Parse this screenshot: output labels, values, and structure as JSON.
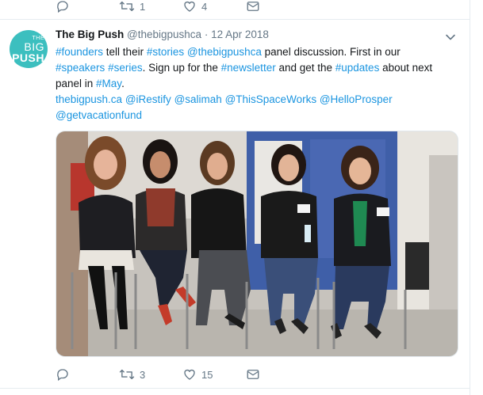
{
  "previous_tweet": {
    "actions": [
      {
        "name": "reply",
        "icon": "reply-icon",
        "count": ""
      },
      {
        "name": "retweet",
        "icon": "retweet-icon",
        "count": "1"
      },
      {
        "name": "like",
        "icon": "heart-icon",
        "count": "4"
      },
      {
        "name": "message",
        "icon": "envelope-icon",
        "count": ""
      }
    ]
  },
  "tweet": {
    "avatar": {
      "line1": "THE",
      "line2": "BIG",
      "line3": "PUSH",
      "color": "#3cbfbf"
    },
    "display_name": "The Big Push",
    "handle": "@thebigpushca",
    "separator": "·",
    "date": "12 Apr 2018",
    "text": {
      "line1": {
        "t1": "#founders",
        "t2": " tell their ",
        "t3": "#stories",
        "t4": " ",
        "t5": "@thebigpushca",
        "t6": " panel discussion. First in our"
      },
      "line2": {
        "t1": "#speakers",
        "t2": " ",
        "t3": "#series",
        "t4": ". Sign up for the ",
        "t5": "#newsletter",
        "t6": " and get the ",
        "t7": "#updates",
        "t8": " about next"
      },
      "line3": {
        "t1": "panel in ",
        "t2": "#May",
        "t3": "."
      },
      "line4": {
        "t1": "thebigpush.ca",
        "t2": " ",
        "t3": "@iRestify",
        "t4": " ",
        "t5": "@salimah",
        "t6": " ",
        "t7": "@ThisSpaceWorks",
        "t8": " ",
        "t9": "@HelloProsper"
      },
      "line5": {
        "t1": "@getvacationfund"
      }
    },
    "photo_description_icon": "photo-of-five-women-seated-on-stools",
    "actions": [
      {
        "name": "reply",
        "icon": "reply-icon",
        "count": ""
      },
      {
        "name": "retweet",
        "icon": "retweet-icon",
        "count": "3"
      },
      {
        "name": "like",
        "icon": "heart-icon",
        "count": "15"
      },
      {
        "name": "message",
        "icon": "envelope-icon",
        "count": ""
      }
    ]
  },
  "colors": {
    "link": "#1b95e0",
    "muted": "#657786",
    "border": "#e6ecf0",
    "brand": "#3cbfbf"
  }
}
